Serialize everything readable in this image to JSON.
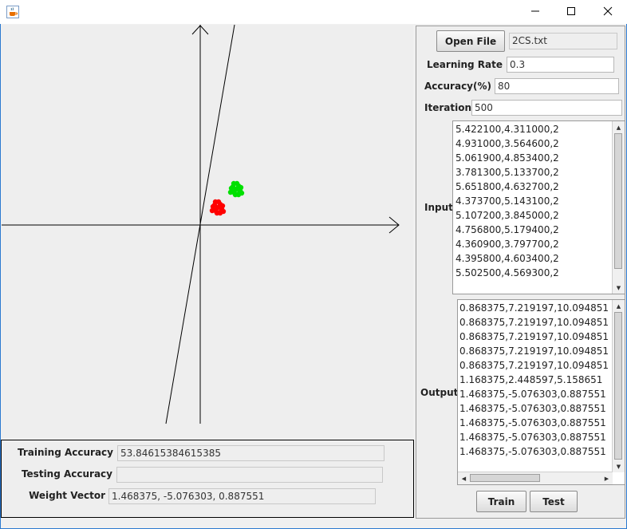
{
  "window": {
    "minimize_label": "—",
    "maximize_label": "☐",
    "close_label": "✕"
  },
  "controls": {
    "open_file_label": "Open File",
    "file_name": "2CS.txt",
    "learning_rate_label": "Learning Rate",
    "learning_rate_value": "0.3",
    "accuracy_label": "Accuracy(%)",
    "accuracy_value": "80",
    "iteration_label": "Iteration",
    "iteration_value": "500",
    "input_label": "Input",
    "output_label": "Output",
    "train_label": "Train",
    "test_label": "Test"
  },
  "input_lines": [
    "5.422100,4.311000,2",
    "4.931000,3.564600,2",
    "5.061900,4.853400,2",
    "3.781300,5.133700,2",
    "5.651800,4.632700,2",
    "4.373700,5.143100,2",
    "5.107200,3.845000,2",
    "4.756800,5.179400,2",
    "4.360900,3.797700,2",
    "4.395800,4.603400,2",
    "5.502500,4.569300,2"
  ],
  "output_lines": [
    "0.868375,7.219197,10.094851",
    "0.868375,7.219197,10.094851",
    "0.868375,7.219197,10.094851",
    "0.868375,7.219197,10.094851",
    "0.868375,7.219197,10.094851",
    "1.168375,2.448597,5.158651",
    "1.468375,-5.076303,0.887551",
    "1.468375,-5.076303,0.887551",
    "1.468375,-5.076303,0.887551",
    "1.468375,-5.076303,0.887551",
    "1.468375,-5.076303,0.887551"
  ],
  "results": {
    "training_accuracy_label": "Training Accuracy",
    "training_accuracy_value": "53.84615384615385",
    "testing_accuracy_label": "Testing Accuracy",
    "testing_accuracy_value": "",
    "weight_vector_label": "Weight Vector",
    "weight_vector_value": "1.468375, -5.076303, 0.887551"
  },
  "colors": {
    "class_red": "#ff0000",
    "class_green": "#00e000",
    "axis": "#000000"
  },
  "icons": {
    "app": "java-coffee-cup-icon",
    "minimize": "minimize-icon",
    "maximize": "maximize-icon",
    "close": "close-icon"
  }
}
